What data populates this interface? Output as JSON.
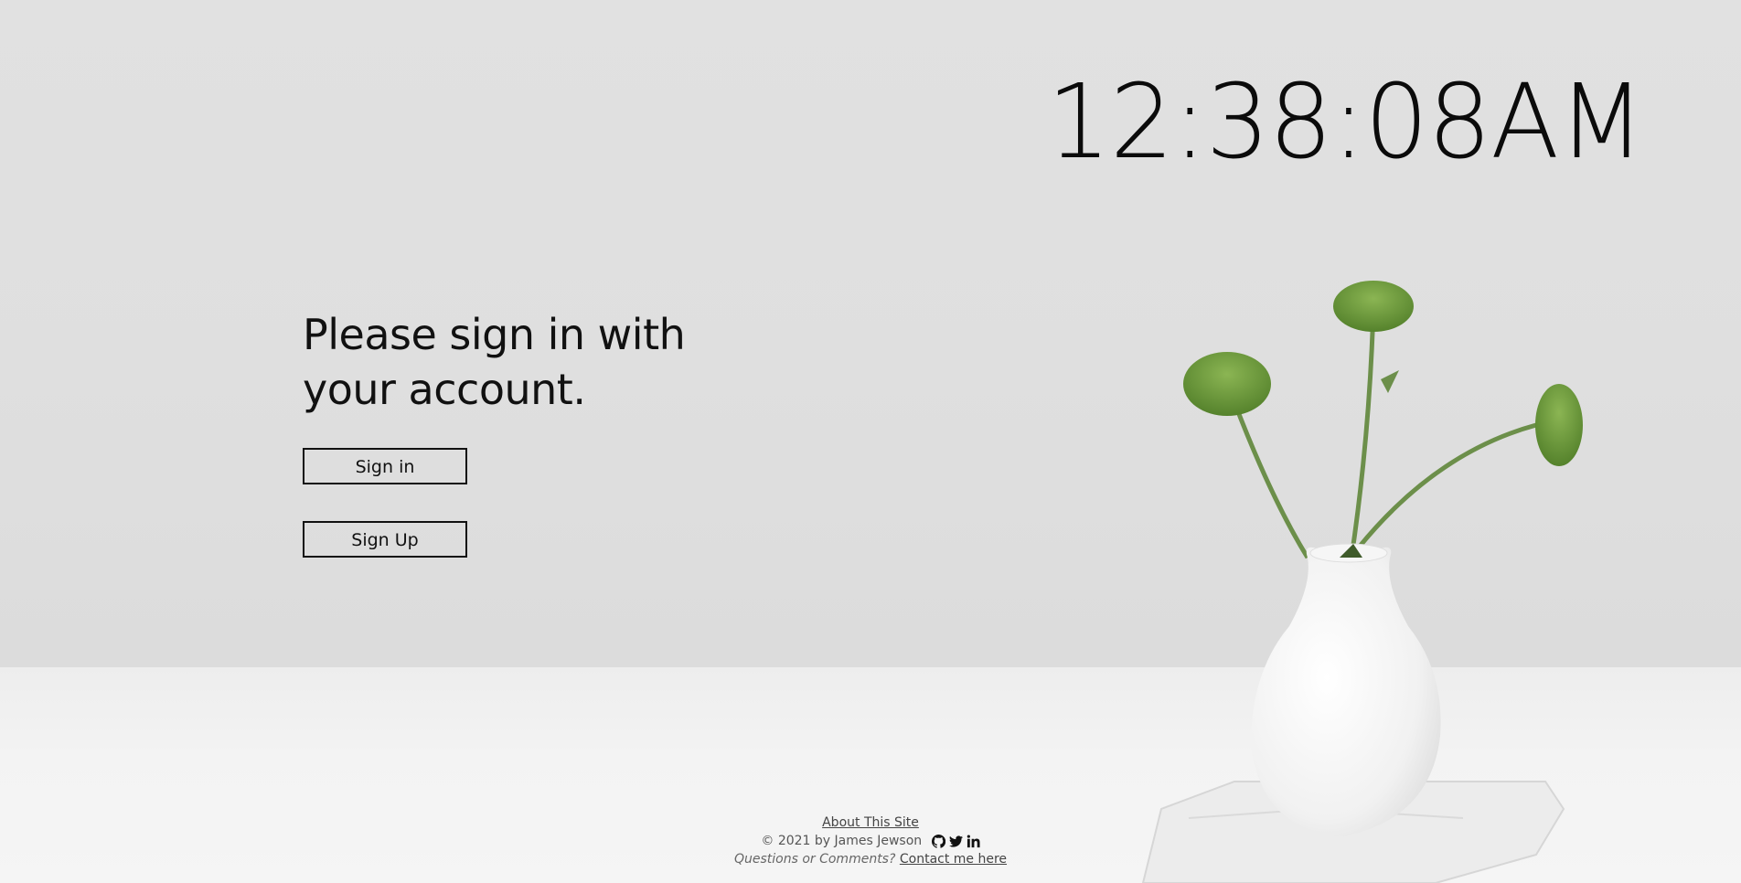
{
  "clock": {
    "time": "12:38:08AM"
  },
  "signin": {
    "headline_line1": "Please sign in with",
    "headline_line2": "your account.",
    "signin_label": "Sign in",
    "signup_label": "Sign Up"
  },
  "footer": {
    "about_link": "About This Site",
    "copyright": "© 2021 by James Jewson",
    "social_icons": [
      "github-icon",
      "twitter-icon",
      "linkedin-icon"
    ],
    "questions": "Questions or Comments?",
    "contact_link": "Contact me here"
  },
  "colors": {
    "wall": "#e0e0e0",
    "table": "#f3f3f3",
    "text": "#111111",
    "leaf_green": "#6f9a3e"
  }
}
